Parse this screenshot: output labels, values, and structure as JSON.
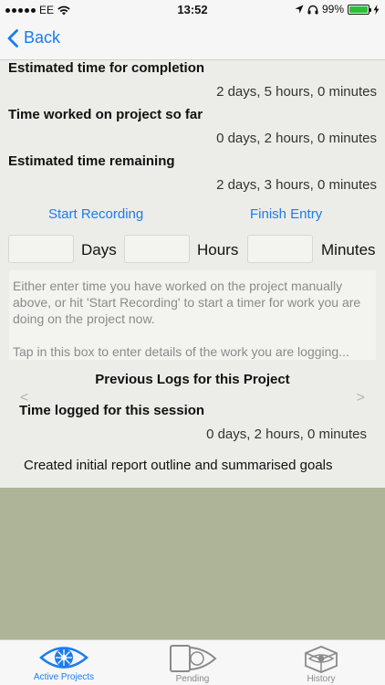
{
  "status_bar": {
    "carrier": "EE",
    "time": "13:52",
    "battery": "99%"
  },
  "nav": {
    "back_label": "Back"
  },
  "summary": {
    "estimated_label": "Estimated time for completion",
    "estimated_value": "2 days, 5 hours, 0 minutes",
    "worked_label": "Time worked on project so far",
    "worked_value": "0 days, 2 hours, 0 minutes",
    "remaining_label": "Estimated time remaining",
    "remaining_value": "2 days, 3 hours, 0 minutes"
  },
  "actions": {
    "start_recording": "Start Recording",
    "finish_entry": "Finish Entry"
  },
  "time_entry": {
    "days_label": "Days",
    "hours_label": "Hours",
    "minutes_label": "Minutes"
  },
  "notes": {
    "line1": "Either enter time you have worked on the project manually above, or hit 'Start Recording' to start a timer for work you are doing on the project now.",
    "line2": "Tap in this box to enter details of the work you are logging..."
  },
  "previous_logs": {
    "title": "Previous Logs for this Project",
    "prev_arrow": "<",
    "next_arrow": ">",
    "session_label": "Time logged for this session",
    "session_value": "0 days, 2 hours, 0 minutes",
    "description": "Created initial report outline and summarised goals"
  },
  "tabs": [
    {
      "label": "Active Projects",
      "icon": "eye-icon",
      "active": true
    },
    {
      "label": "Pending",
      "icon": "pending-eye-icon",
      "active": false
    },
    {
      "label": "History",
      "icon": "history-icon",
      "active": false
    }
  ],
  "colors": {
    "accent": "#1a7cf0",
    "olive": "#adb497",
    "background": "#ecede8"
  }
}
